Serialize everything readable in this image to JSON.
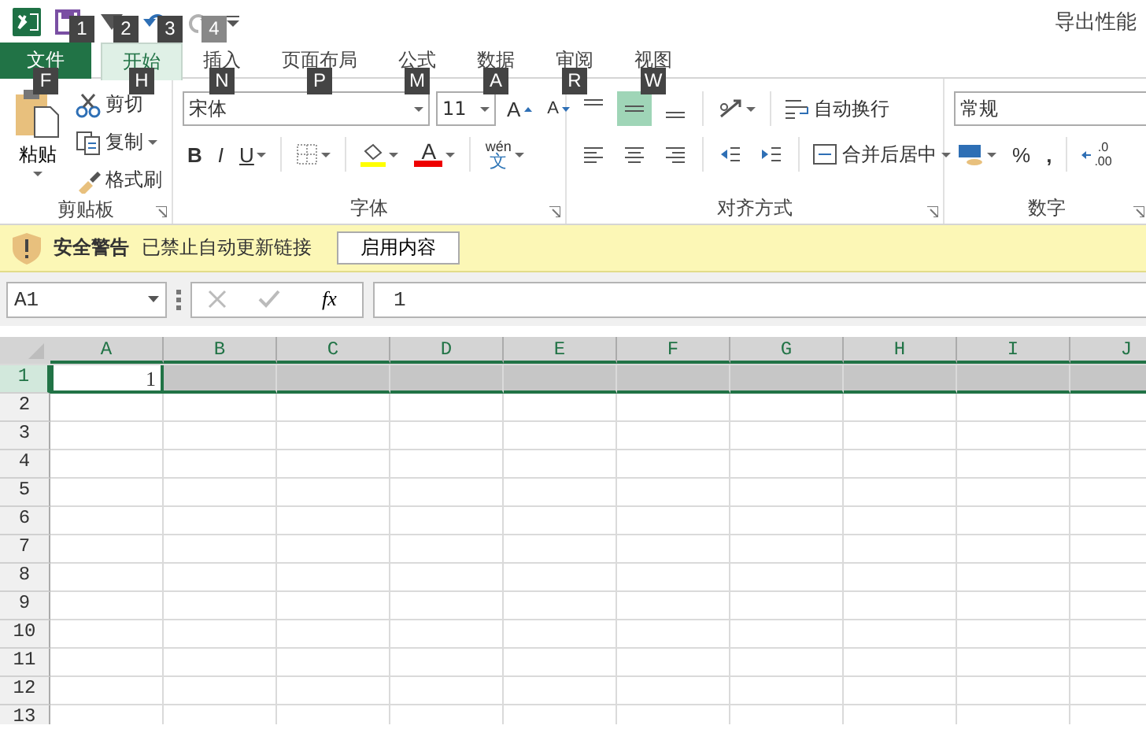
{
  "window": {
    "title": "导出性能"
  },
  "quick_access": [
    {
      "kind": "save",
      "keytip": "1",
      "disabled": false
    },
    {
      "kind": "touch",
      "keytip": "2",
      "disabled": false
    },
    {
      "kind": "undo",
      "keytip": "3",
      "disabled": false
    },
    {
      "kind": "redo",
      "keytip": "4",
      "disabled": true
    }
  ],
  "tabs": [
    {
      "kind": "file",
      "label": "文件",
      "keytip": "F",
      "selected": false
    },
    {
      "kind": "tab",
      "label": "开始",
      "keytip": "H",
      "selected": true
    },
    {
      "kind": "tab",
      "label": "插入",
      "keytip": "N",
      "selected": false
    },
    {
      "kind": "tab",
      "label": "页面布局",
      "keytip": "P",
      "selected": false
    },
    {
      "kind": "tab",
      "label": "公式",
      "keytip": "M",
      "selected": false
    },
    {
      "kind": "tab",
      "label": "数据",
      "keytip": "A",
      "selected": false
    },
    {
      "kind": "tab",
      "label": "审阅",
      "keytip": "R",
      "selected": false
    },
    {
      "kind": "tab",
      "label": "视图",
      "keytip": "W",
      "selected": false
    }
  ],
  "clipboard": {
    "label": "剪贴板",
    "paste": "粘贴",
    "items": [
      "剪切",
      "复制",
      "格式刷"
    ]
  },
  "font": {
    "label": "字体",
    "name": "宋体",
    "size": "11",
    "grow": "A",
    "shrink": "A",
    "bold": "B",
    "italic": "I",
    "underline": "U",
    "font_color": "A",
    "phonetic_top": "wén",
    "phonetic_bottom": "文"
  },
  "alignment": {
    "label": "对齐方式",
    "vertical": [
      {
        "selected": false
      },
      {
        "selected": true
      },
      {
        "selected": false
      }
    ],
    "wrap": "自动换行",
    "merge": "合并后居中"
  },
  "number": {
    "label": "数字",
    "format": "常规",
    "percent": "%",
    "comma": ",",
    "decimal_top": ".0",
    "decimal_bottom": ".00"
  },
  "warning": {
    "title": "安全警告",
    "message": "已禁止自动更新链接",
    "button": "启用内容"
  },
  "formula_bar": {
    "name_box": "A1",
    "fx": "fx",
    "value": "1"
  },
  "sheet": {
    "columns": [
      "A",
      "B",
      "C",
      "D",
      "E",
      "F",
      "G",
      "H",
      "I",
      "J"
    ],
    "rows": [
      {
        "label": "1",
        "selected": true,
        "cells": [
          "1"
        ]
      },
      {
        "label": "2",
        "selected": false
      },
      {
        "label": "3",
        "selected": false
      },
      {
        "label": "4",
        "selected": false
      },
      {
        "label": "5",
        "selected": false
      },
      {
        "label": "6",
        "selected": false
      },
      {
        "label": "7",
        "selected": false
      },
      {
        "label": "8",
        "selected": false
      },
      {
        "label": "9",
        "selected": false
      },
      {
        "label": "10",
        "selected": false
      },
      {
        "label": "11",
        "selected": false
      },
      {
        "label": "12",
        "selected": false
      },
      {
        "label": "13",
        "selected": false
      }
    ]
  }
}
